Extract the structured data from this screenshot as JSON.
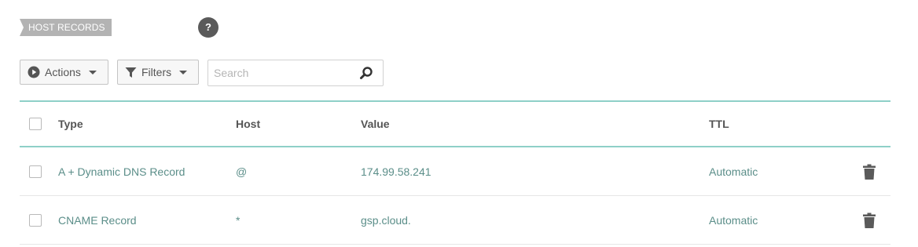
{
  "section": {
    "title": "HOST RECORDS",
    "help_glyph": "?"
  },
  "toolbar": {
    "actions_label": "Actions",
    "filters_label": "Filters",
    "search_placeholder": "Search"
  },
  "table": {
    "columns": [
      "Type",
      "Host",
      "Value",
      "TTL"
    ],
    "rows": [
      {
        "type": "A + Dynamic DNS Record",
        "host": "@",
        "value": "174.99.58.241",
        "ttl": "Automatic"
      },
      {
        "type": "CNAME Record",
        "host": "*",
        "value": "gsp.cloud.",
        "ttl": "Automatic"
      }
    ]
  },
  "colors": {
    "accent_border": "#8ed0c8",
    "row_text": "#5b8e89",
    "tag_bg": "#b3b3b3",
    "help_bg": "#5a5a5a"
  },
  "icons": {
    "help": "question-icon",
    "actions": "play-circle-icon",
    "filters": "funnel-icon",
    "search": "magnifier-icon",
    "delete": "trash-icon"
  }
}
